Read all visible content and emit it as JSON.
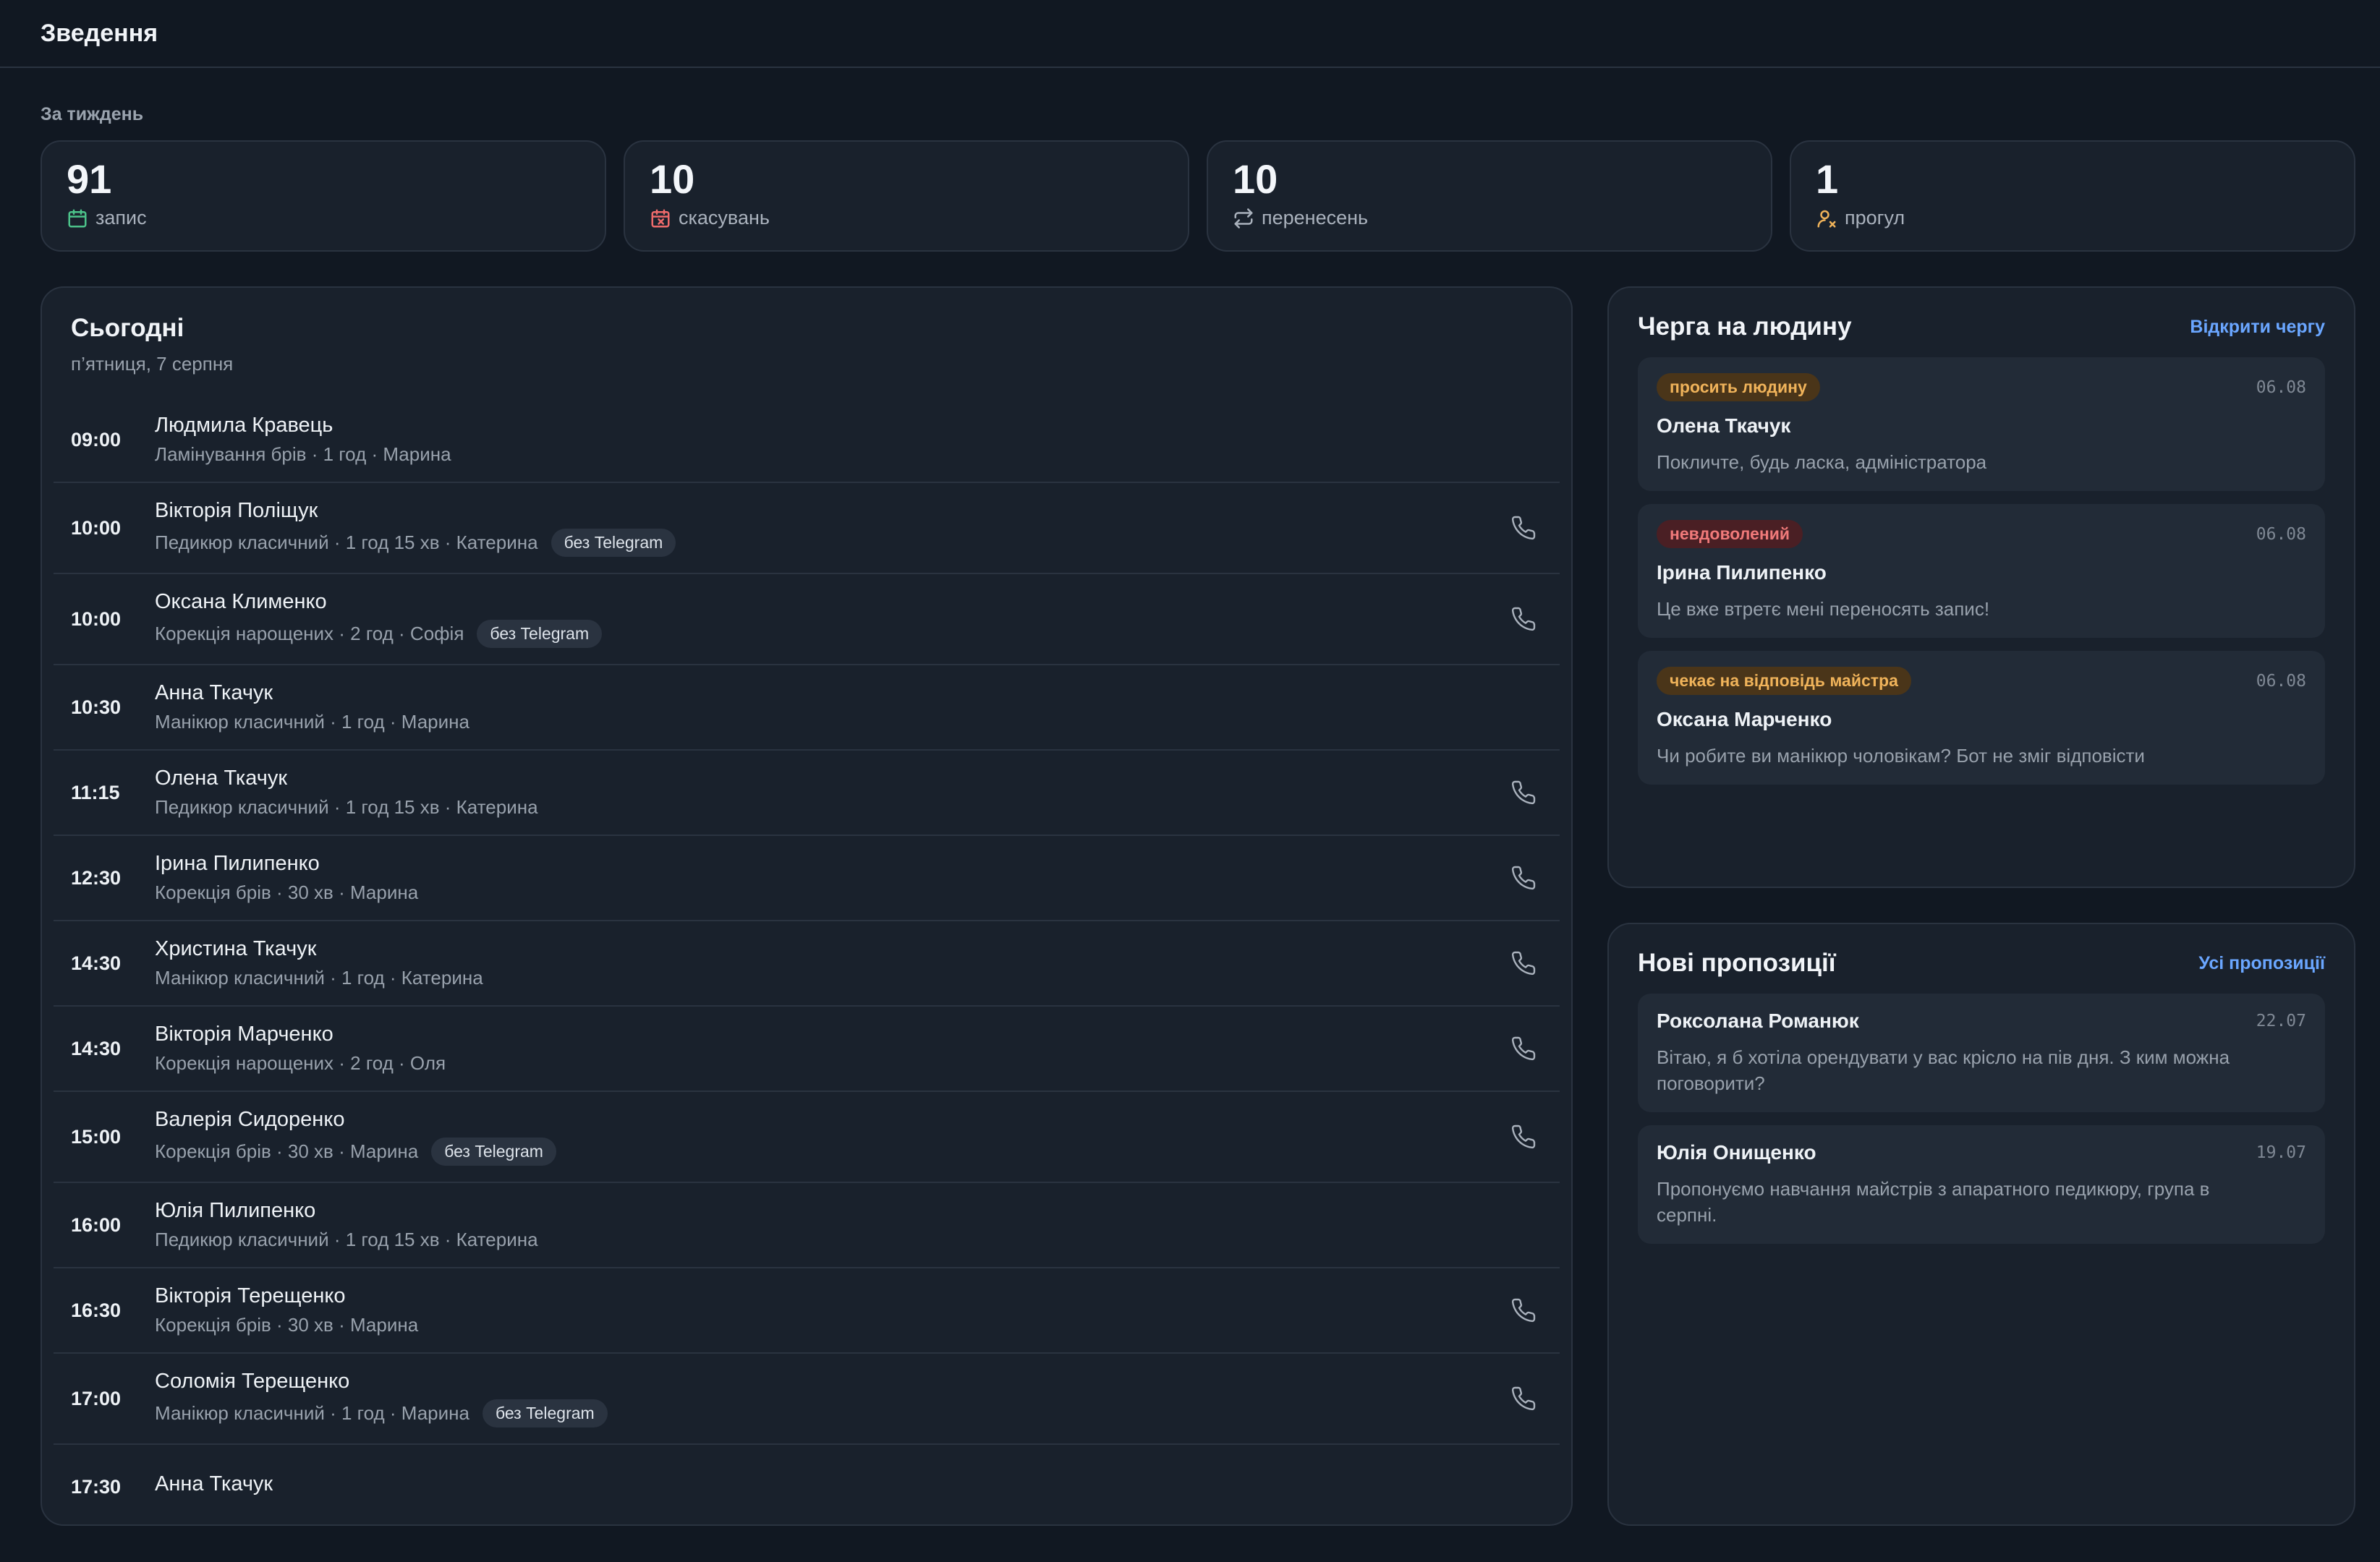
{
  "header": {
    "title": "Зведення"
  },
  "week": {
    "label": "За тиждень",
    "stats": [
      {
        "value": "91",
        "label": "запис",
        "icon": "calendar-icon",
        "color": "#4cc38a"
      },
      {
        "value": "10",
        "label": "скасувань",
        "icon": "calendar-x-icon",
        "color": "#ef6b6b"
      },
      {
        "value": "10",
        "label": "перенесень",
        "icon": "repeat-icon",
        "color": "#aab2bd"
      },
      {
        "value": "1",
        "label": "прогул",
        "icon": "user-x-icon",
        "color": "#f0b35a"
      }
    ]
  },
  "today": {
    "title": "Сьогодні",
    "subtitle": "п’ятниця, 7 серпня",
    "appointments": [
      {
        "time": "09:00",
        "name": "Людмила Кравець",
        "meta": "Ламінування брів · 1 год · Марина",
        "badge": "",
        "phone": false
      },
      {
        "time": "10:00",
        "name": "Вікторія Поліщук",
        "meta": "Педикюр класичний · 1 год 15 хв · Катерина",
        "badge": "без Telegram",
        "phone": true
      },
      {
        "time": "10:00",
        "name": "Оксана Клименко",
        "meta": "Корекція нарощених · 2 год · Софія",
        "badge": "без Telegram",
        "phone": true
      },
      {
        "time": "10:30",
        "name": "Анна Ткачук",
        "meta": "Манікюр класичний · 1 год · Марина",
        "badge": "",
        "phone": false
      },
      {
        "time": "11:15",
        "name": "Олена Ткачук",
        "meta": "Педикюр класичний · 1 год 15 хв · Катерина",
        "badge": "",
        "phone": true
      },
      {
        "time": "12:30",
        "name": "Ірина Пилипенко",
        "meta": "Корекція брів · 30 хв · Марина",
        "badge": "",
        "phone": true
      },
      {
        "time": "14:30",
        "name": "Христина Ткачук",
        "meta": "Манікюр класичний · 1 год · Катерина",
        "badge": "",
        "phone": true
      },
      {
        "time": "14:30",
        "name": "Вікторія Марченко",
        "meta": "Корекція нарощених · 2 год · Оля",
        "badge": "",
        "phone": true
      },
      {
        "time": "15:00",
        "name": "Валерія Сидоренко",
        "meta": "Корекція брів · 30 хв · Марина",
        "badge": "без Telegram",
        "phone": true
      },
      {
        "time": "16:00",
        "name": "Юлія Пилипенко",
        "meta": "Педикюр класичний · 1 год 15 хв · Катерина",
        "badge": "",
        "phone": false
      },
      {
        "time": "16:30",
        "name": "Вікторія Терещенко",
        "meta": "Корекція брів · 30 хв · Марина",
        "badge": "",
        "phone": true
      },
      {
        "time": "17:00",
        "name": "Соломія Терещенко",
        "meta": "Манікюр класичний · 1 год · Марина",
        "badge": "без Telegram",
        "phone": true
      },
      {
        "time": "17:30",
        "name": "Анна Ткачук",
        "meta": "",
        "badge": "",
        "phone": false
      }
    ]
  },
  "queue": {
    "title": "Черга на людину",
    "link": "Відкрити чергу",
    "items": [
      {
        "status": "просить людину",
        "tone": "orange",
        "date": "06.08",
        "name": "Олена Ткачук",
        "text": "Покличте, будь ласка, адміністратора"
      },
      {
        "status": "невдоволений",
        "tone": "red",
        "date": "06.08",
        "name": "Ірина Пилипенко",
        "text": "Це вже втретє мені переносять запис!"
      },
      {
        "status": "чекає на відповідь майстра",
        "tone": "orange",
        "date": "06.08",
        "name": "Оксана Марченко",
        "text": "Чи робите ви манікюр чоловікам? Бот не зміг відповісти"
      }
    ]
  },
  "offers": {
    "title": "Нові пропозиції",
    "link": "Усі пропозиції",
    "items": [
      {
        "name": "Роксолана Романюк",
        "date": "22.07",
        "text": "Вітаю, я б хотіла орендувати у вас крісло на пів дня. З ким можна поговорити?"
      },
      {
        "name": "Юлія Онищенко",
        "date": "19.07",
        "text": "Пропонуємо навчання майстрів з апаратного педикюру, група в серпні."
      }
    ]
  }
}
